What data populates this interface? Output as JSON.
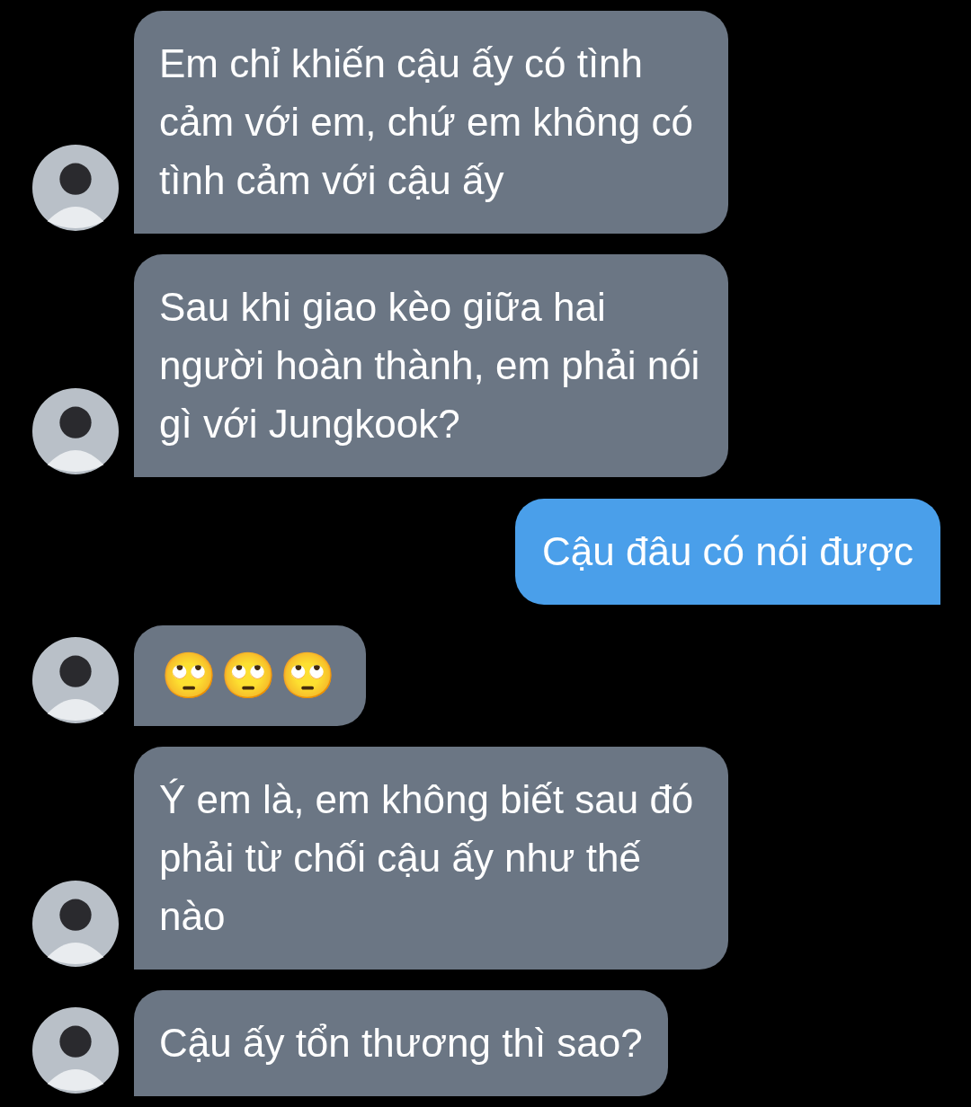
{
  "messages": [
    {
      "kind": "text",
      "sent": false,
      "text": "Em chỉ khiến cậu ấy có tình cảm với em, chứ em không có tình cảm với cậu ấy"
    },
    {
      "kind": "text",
      "sent": false,
      "text": "Sau khi giao kèo giữa hai người hoàn thành, em phải nói gì với Jungkook?"
    },
    {
      "kind": "text",
      "sent": true,
      "text": "Cậu đâu có nói được"
    },
    {
      "kind": "emoji",
      "sent": false,
      "text": "🙄🙄🙄"
    },
    {
      "kind": "text",
      "sent": false,
      "text": "Ý em là, em không biết sau đó phải từ chối cậu ấy như thế nào"
    },
    {
      "kind": "text",
      "sent": false,
      "text": "Cậu ấy tổn thương thì sao?"
    }
  ]
}
